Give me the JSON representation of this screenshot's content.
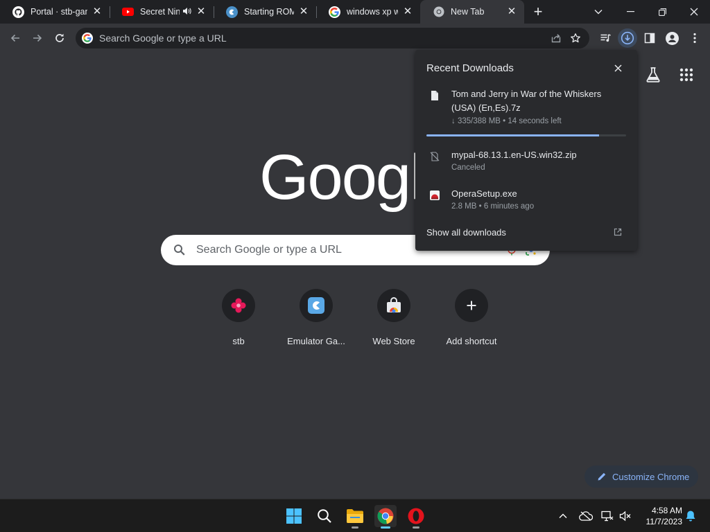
{
  "tabs": [
    {
      "title": "Portal · stb-games",
      "favicon": "github-icon"
    },
    {
      "title": "Secret Nintendo",
      "favicon": "youtube-icon",
      "audio": true
    },
    {
      "title": "Starting ROM Downloads",
      "favicon": "emulator-icon"
    },
    {
      "title": "windows xp wallpaper",
      "favicon": "google-icon"
    },
    {
      "title": "New Tab",
      "favicon": "chrome-icon",
      "active": true
    }
  ],
  "toolbar": {
    "omnibox_placeholder": "Search Google or type a URL"
  },
  "ntp": {
    "logo": "Google",
    "search_placeholder": "Search Google or type a URL",
    "shortcuts": [
      {
        "label": "stb",
        "icon": "stb-flower-icon"
      },
      {
        "label": "Emulator Ga...",
        "icon": "emulator-icon"
      },
      {
        "label": "Web Store",
        "icon": "web-store-icon"
      },
      {
        "label": "Add shortcut",
        "icon": "plus-icon"
      }
    ],
    "customize_label": "Customize Chrome"
  },
  "downloads": {
    "title": "Recent Downloads",
    "items": [
      {
        "name": "Tom and Jerry in War of the Whiskers (USA) (En,Es).7z",
        "status": "↓ 335/388 MB • 14 seconds left",
        "progress": 0.863,
        "icon": "file-icon"
      },
      {
        "name": "mypal-68.13.1.en-US.win32.zip",
        "status": "Canceled",
        "icon": "canceled-file-icon"
      },
      {
        "name": "OperaSetup.exe",
        "status": "2.8 MB • 6 minutes ago",
        "icon": "installer-icon"
      }
    ],
    "show_all": "Show all downloads"
  },
  "taskbar": {
    "time": "4:58 AM",
    "date": "11/7/2023"
  },
  "colors": {
    "accent": "#8ab4f8",
    "page_bg": "#35363a",
    "frame_bg": "#202124"
  }
}
